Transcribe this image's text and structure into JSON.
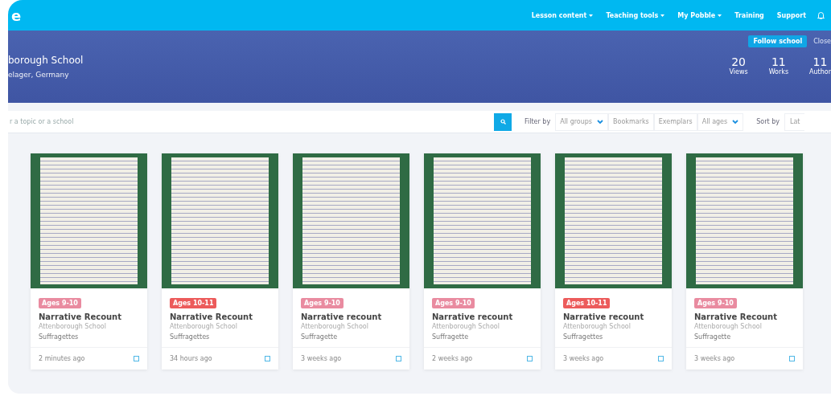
{
  "logo": "e",
  "nav": [
    {
      "label": "Lesson content",
      "dropdown": true
    },
    {
      "label": "Teaching tools",
      "dropdown": true
    },
    {
      "label": "My Pobble",
      "dropdown": true
    },
    {
      "label": "Training",
      "dropdown": false
    },
    {
      "label": "Support",
      "dropdown": false
    }
  ],
  "school": {
    "name": "borough School",
    "location": "elager, Germany",
    "follow_button": "Follow school",
    "close": "Close",
    "stats": [
      {
        "value": "20",
        "label": "Views"
      },
      {
        "value": "11",
        "label": "Works"
      },
      {
        "value": "11",
        "label": "Author"
      }
    ]
  },
  "search": {
    "placeholder": "r a topic or a school"
  },
  "filters": {
    "label": "Filter by",
    "items": [
      {
        "label": "All groups",
        "kind": "dropdown"
      },
      {
        "label": "Bookmarks",
        "kind": "toggle"
      },
      {
        "label": "Exemplars",
        "kind": "toggle"
      },
      {
        "label": "All ages",
        "kind": "dropdown"
      }
    ],
    "sort_label": "Sort by",
    "sort_value": "Lat"
  },
  "works": [
    {
      "tag": "Ages 9-10",
      "color": "#e98ba0",
      "title": "Narrative Recount",
      "school": "Attenborough School",
      "topic": "Suffragettes",
      "time": "2 minutes ago"
    },
    {
      "tag": "Ages 10-11",
      "color": "#ec5b5b",
      "title": "Narrative Recount",
      "school": "Attenborough School",
      "topic": "Suffragettes",
      "time": "34 hours ago"
    },
    {
      "tag": "Ages 9-10",
      "color": "#e98ba0",
      "title": "Narrative recount",
      "school": "Attenborough School",
      "topic": "Suffragette",
      "time": "3 weeks ago"
    },
    {
      "tag": "Ages 9-10",
      "color": "#e98ba0",
      "title": "Narrative recount",
      "school": "Attenborough School",
      "topic": "Suffragette",
      "time": "2 weeks ago"
    },
    {
      "tag": "Ages 10-11",
      "color": "#ec5b5b",
      "title": "Narrative recount",
      "school": "Attenborough School",
      "topic": "Suffragettes",
      "time": "3 weeks ago"
    },
    {
      "tag": "Ages 9-10",
      "color": "#e98ba0",
      "title": "Narrative Recount",
      "school": "Attenborough School",
      "topic": "Suffragette",
      "time": "3 weeks ago"
    }
  ]
}
